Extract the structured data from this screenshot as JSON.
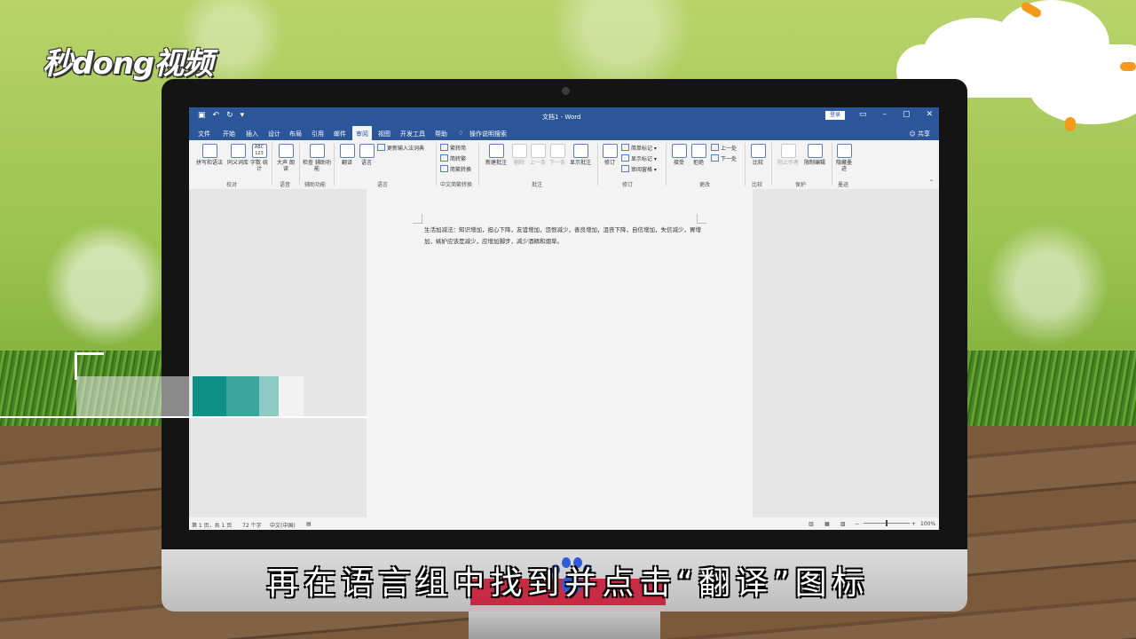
{
  "brand": {
    "logo_text": "秒dong视频"
  },
  "caption": "再在语言组中找到并点击“翻译”图标",
  "word": {
    "title": "文档1 - Word",
    "signin_label": "登录",
    "share_label": "共享",
    "menu_tabs": [
      "文件",
      "开始",
      "插入",
      "设计",
      "布局",
      "引用",
      "邮件",
      "审阅",
      "视图",
      "开发工具",
      "帮助"
    ],
    "active_tab": "审阅",
    "tell_me": "操作说明搜索",
    "ribbon": {
      "proofing": {
        "spelling": "拼写和语法",
        "thesaurus": "同义词库",
        "wordcount_icon": "ABC 123",
        "wordcount": "字数 统计",
        "group": "校对"
      },
      "speech": {
        "read_aloud": "大声 朗读",
        "group": "语音"
      },
      "accessibility": {
        "check": "检查 辅助功能",
        "group": "辅助功能"
      },
      "language": {
        "translate": "翻译",
        "language": "语言",
        "update_ime": "更新输入法词典",
        "group": "语言"
      },
      "chinese_conversion": {
        "to_simplified": "繁转简",
        "to_traditional": "简转繁",
        "convert": "简繁转换",
        "group": "中文简繁转换"
      },
      "comments": {
        "new": "新建批注",
        "delete": "删除",
        "prev": "上一条",
        "next": "下一条",
        "show": "显示批注",
        "group": "批注"
      },
      "tracking": {
        "track": "修订",
        "simple_markup": "简单标记",
        "show_markup": "显示标记",
        "reviewing_pane": "审阅窗格",
        "group": "修订"
      },
      "changes": {
        "accept": "接受",
        "reject": "拒绝",
        "prev": "上一处",
        "next": "下一处",
        "group": "更改"
      },
      "compare": {
        "compare": "比较",
        "group": "比较"
      },
      "protect": {
        "block_authors": "阻止作者",
        "restrict": "限制编辑",
        "group": "保护"
      },
      "ink": {
        "hide_ink": "隐藏墨迹",
        "group": "墨迹"
      }
    },
    "document_text": "生活加减法：知识增加，担心下降，友谊增加，怨恨减少，善良增加，沮丧下降，自信增加，失信减少，胃增加，嫉妒应该是减少，应增加脚步，减少酒精和烟草。",
    "status": {
      "page": "第 1 页，共 1 页",
      "words": "72 个字",
      "language": "中文(中国)",
      "zoom": "100%"
    }
  }
}
